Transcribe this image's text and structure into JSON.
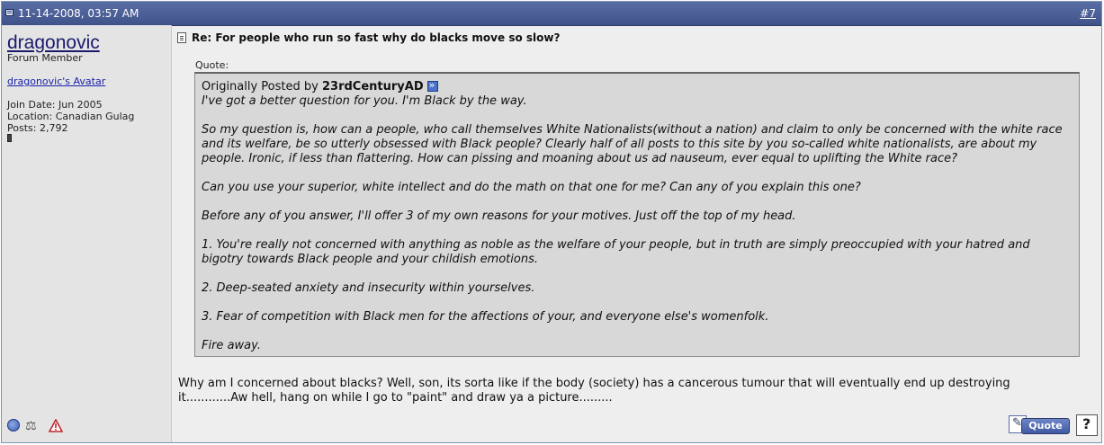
{
  "header": {
    "date": "11-14-2008, 03:57 AM",
    "post_number": "#7"
  },
  "user": {
    "name": "dragonovic",
    "title": "Forum Member",
    "avatar_link": "dragonovic's Avatar",
    "join_date": "Join Date: Jun 2005",
    "location": "Location: Canadian Gulag",
    "posts": "Posts: 2,792"
  },
  "post": {
    "title": "Re: For people who run so fast why do blacks move so slow?",
    "quote_label": "Quote:",
    "quote_origin_prefix": "Originally Posted by",
    "quote_author": "23rdCenturyAD",
    "quote_paragraphs": [
      "I've got a better question for you. I'm Black by the way.",
      "So my question is, how can a people, who call themselves White Nationalists(without a nation) and claim to only be concerned with the white race and its welfare, be so utterly obsessed with Black people? Clearly half of all posts to this site by you so-called white nationalists, are about my people. Ironic, if less than flattering. How can pissing and moaning about us ad nauseum, ever equal to uplifting the White race?",
      "Can you use your superior, white intellect and do the math on that one for me? Can any of you explain this one?",
      "Before any of you answer, I'll offer 3 of my own reasons for your motives. Just off the top of my head.",
      "1. You're really not concerned with anything as noble as the welfare of your people, but in truth are simply preoccupied with your hatred and bigotry towards Black people and your childish emotions.",
      "2. Deep-seated anxiety and insecurity within yourselves.",
      "3. Fear of competition with Black men for the affections of your, and everyone else's womenfolk.",
      "Fire away."
    ],
    "body": "Why am I concerned about blacks? Well, son, its sorta like if the body (society) has a cancerous tumour that will eventually end up destroying it............Aw hell, hang on while I go to \"paint\" and draw ya a picture........."
  },
  "buttons": {
    "quote": "Quote"
  },
  "icons": {
    "post_icon": "post-icon",
    "online": "online-status-icon",
    "reputation": "reputation-icon",
    "report": "report-icon",
    "view_post": "view-post-icon",
    "multiquote": "multiquote-icon"
  }
}
